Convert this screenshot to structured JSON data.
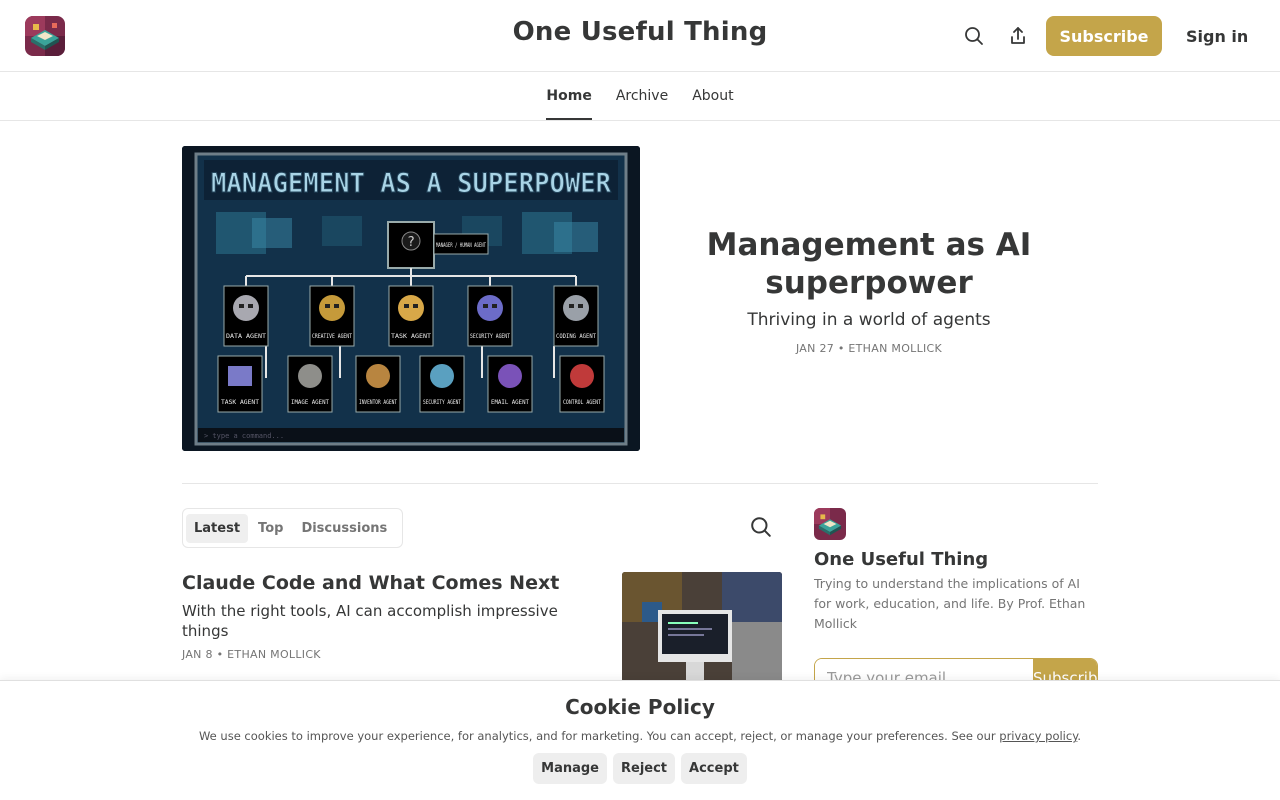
{
  "header": {
    "site_title": "One Useful Thing",
    "subscribe_label": "Subscribe",
    "signin_label": "Sign in",
    "accent_color": "#c4a54a"
  },
  "nav": {
    "tabs": [
      {
        "label": "Home",
        "active": true
      },
      {
        "label": "Archive",
        "active": false
      },
      {
        "label": "About",
        "active": false
      }
    ]
  },
  "hero": {
    "image_heading": "MANAGEMENT AS A SUPERPOWER",
    "image_manager_label": "MANAGER / HUMAN AGENT",
    "image_row1": [
      "DATA AGENT",
      "CREATIVE AGENT",
      "TASK AGENT",
      "SECURITY AGENT",
      "CODING AGENT"
    ],
    "image_row2": [
      "TASK AGENT",
      "IMAGE AGENT",
      "INVENTOR AGENT",
      "SECURITY AGENT",
      "EMAIL AGENT",
      "CONTROL AGENT"
    ],
    "image_prompt": "> type a command...",
    "title": "Management as AI superpower",
    "subtitle": "Thriving in a world of agents",
    "meta": "JAN 27 • ETHAN MOLLICK"
  },
  "feed": {
    "tabs": [
      {
        "label": "Latest",
        "active": true
      },
      {
        "label": "Top",
        "active": false
      },
      {
        "label": "Discussions",
        "active": false
      }
    ],
    "posts": [
      {
        "title": "Claude Code and What Comes Next",
        "subtitle": "With the right tools, AI can accomplish impressive things",
        "meta": "JAN 8 • ETHAN MOLLICK"
      }
    ]
  },
  "sidebar": {
    "name": "One Useful Thing",
    "description": "Trying to understand the implications of AI for work, education, and life. By Prof. Ethan Mollick",
    "email_placeholder": "Type your email...",
    "subscribe_label": "Subscribe"
  },
  "cookie": {
    "title": "Cookie Policy",
    "text_before": "We use cookies to improve your experience, for analytics, and for marketing. You can accept, reject, or manage your preferences. See our ",
    "link": "privacy policy",
    "text_after": ".",
    "buttons": {
      "manage": "Manage",
      "reject": "Reject",
      "accept": "Accept"
    }
  }
}
